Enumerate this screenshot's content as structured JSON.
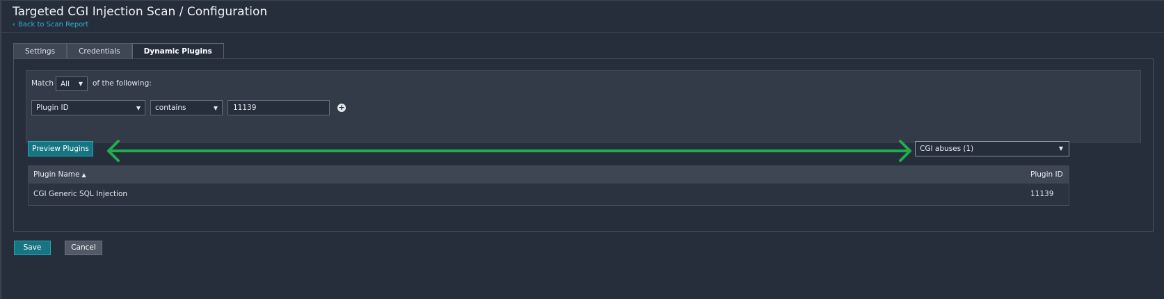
{
  "header": {
    "title": "Targeted CGI Injection Scan / Configuration",
    "back_link": "Back to Scan Report"
  },
  "tabs": [
    {
      "label": "Settings",
      "active": false
    },
    {
      "label": "Credentials",
      "active": false
    },
    {
      "label": "Dynamic Plugins",
      "active": true
    }
  ],
  "filter": {
    "match_label": "Match",
    "match_value": "All",
    "of_following": "of the following:",
    "rule": {
      "field": "Plugin ID",
      "operator": "contains",
      "value": "11139"
    }
  },
  "preview_button": "Preview Plugins",
  "family_select": "CGI abuses (1)",
  "table": {
    "columns": [
      "Plugin Name",
      "Plugin ID"
    ],
    "sort_indicator": "▲",
    "rows": [
      {
        "name": "CGI Generic SQL Injection",
        "id": "11139"
      }
    ]
  },
  "footer": {
    "save_label": "Save",
    "cancel_label": "Cancel"
  },
  "colors": {
    "background": "#262d3b",
    "accent_button": "#167583",
    "link": "#2bb3d6",
    "annotation_arrow": "#1fae4b"
  },
  "icons": {
    "back": "chevron-left-icon",
    "dropdown": "caret-down-icon",
    "add_rule": "plus-circle-icon",
    "annotation": "double-headed-arrow-icon"
  }
}
